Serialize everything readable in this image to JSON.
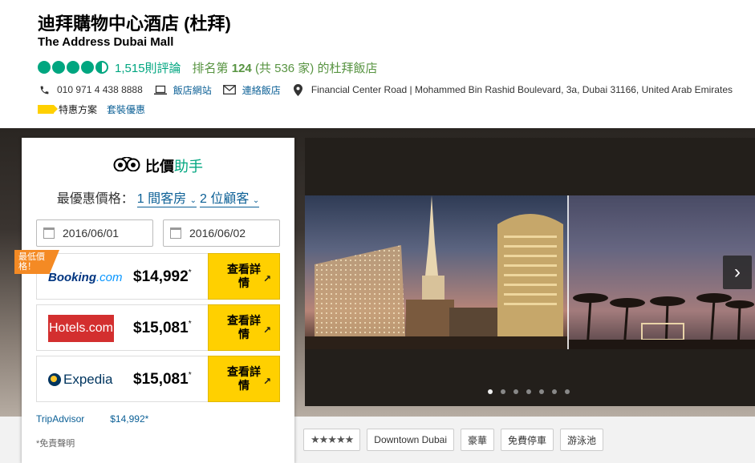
{
  "header": {
    "hotel_name": "迪拜購物中心酒店 (杜拜)",
    "hotel_subname": "The Address Dubai Mall",
    "rating_bubbles": 4.5,
    "review_count": "1,515則評論",
    "rank_prefix": "排名第",
    "rank_number": "124",
    "rank_suffix": "(共 536 家) 的杜拜飯店",
    "phone": "010 971 4 438 8888",
    "website_label": "飯店網站",
    "email_label": "連絡飯店",
    "address": "Financial Center Road | Mohammed Bin Rashid Boulevard, 3a, Dubai 31166, United Arab Emirates",
    "deal_label": "特惠方案",
    "package_label": "套裝優惠"
  },
  "widget": {
    "title_bold": "比價",
    "title_green": "助手",
    "best_price_label": "最優惠價格：",
    "rooms": "1 間客房",
    "guests": "2 位顧客",
    "checkin": "2016/06/01",
    "checkout": "2016/06/02",
    "lowest_badge": "最低價格！",
    "view_deal_label": "查看詳情",
    "offers": [
      {
        "provider": "Booking.com",
        "logo_main": "Booking",
        "logo_suffix": ".com",
        "price": "$14,992",
        "mark": "*"
      },
      {
        "provider": "Hotels.com",
        "logo_text": "Hotels.com",
        "price": "$15,081",
        "mark": "*"
      },
      {
        "provider": "Expedia",
        "logo_text": "Expedia",
        "price": "$15,081",
        "mark": "*"
      }
    ],
    "tripadvisor_label": "TripAdvisor",
    "tripadvisor_price": "$14,992*",
    "disclaimer": "*免責聲明"
  },
  "carousel": {
    "next_icon": "›",
    "dot_count": 7,
    "active_dot": 0
  },
  "tags": {
    "stars": "★★★★★",
    "items": [
      "Downtown Dubai",
      "豪華",
      "免費停車",
      "游泳池"
    ]
  },
  "colors": {
    "brand_green": "#00a680",
    "rank_green": "#589442",
    "link_blue": "#0c6096",
    "cta_yellow": "#ffd000",
    "badge_orange": "#f48a24"
  }
}
